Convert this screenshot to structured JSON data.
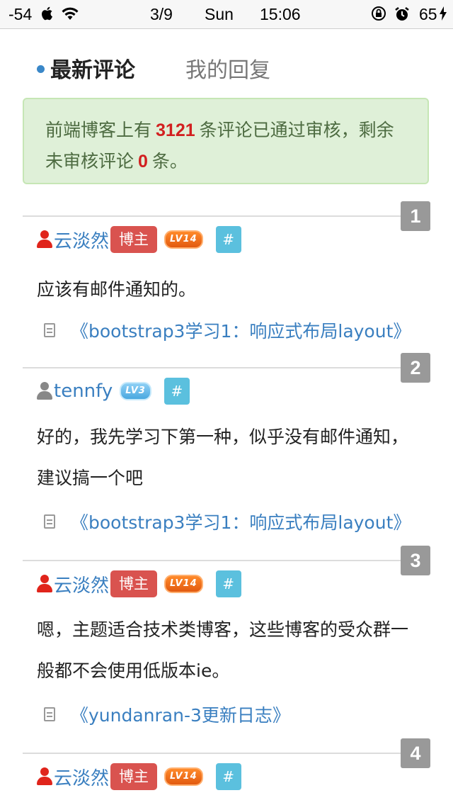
{
  "status_bar": {
    "signal": "-54",
    "date": "3/9",
    "day": "Sun",
    "time": "15:06",
    "battery": "65"
  },
  "tabs": {
    "active": "最新评论",
    "other": "我的回复"
  },
  "notice": {
    "prefix": "前端博客上有",
    "count": "3121",
    "middle": "条评论已通过审核，剩余未审核评论",
    "pending": "0",
    "suffix": "条。"
  },
  "comments": [
    {
      "index": "1",
      "user": "云淡然",
      "user_color": "#e0241b",
      "owner_badge": "博主",
      "level": "LV14",
      "hash": "#",
      "text": "应该有邮件通知的。",
      "post": "《bootstrap3学习1：响应式布局layout》"
    },
    {
      "index": "2",
      "user": "tennfy",
      "user_color": "#888888",
      "owner_badge": "",
      "level": "LV3",
      "hash": "#",
      "text": "好的，我先学习下第一种，似乎没有邮件通知，建议搞一个吧",
      "post": "《bootstrap3学习1：响应式布局layout》"
    },
    {
      "index": "3",
      "user": "云淡然",
      "user_color": "#e0241b",
      "owner_badge": "博主",
      "level": "LV14",
      "hash": "#",
      "text": "嗯，主题适合技术类博客，这些博客的受众群一般都不会使用低版本ie。",
      "post": "《yundanran-3更新日志》"
    },
    {
      "index": "4",
      "user": "云淡然",
      "user_color": "#e0241b",
      "owner_badge": "博主",
      "level": "LV14",
      "hash": "#"
    }
  ]
}
